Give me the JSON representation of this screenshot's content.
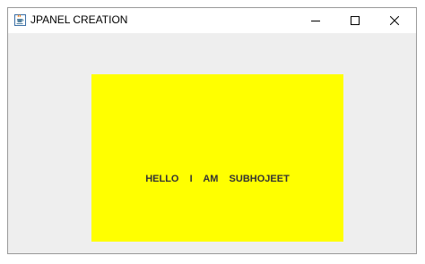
{
  "window": {
    "title": "JPANEL CREATION",
    "icon": "java-cup-icon",
    "controls": {
      "minimize": "minimize-icon",
      "maximize": "maximize-icon",
      "close": "close-icon"
    }
  },
  "panel": {
    "label": "HELLO  I  AM  SUBHOJEET",
    "background": "#ffff00"
  },
  "colors": {
    "content_background": "#eeeeee",
    "titlebar_background": "#ffffff"
  }
}
